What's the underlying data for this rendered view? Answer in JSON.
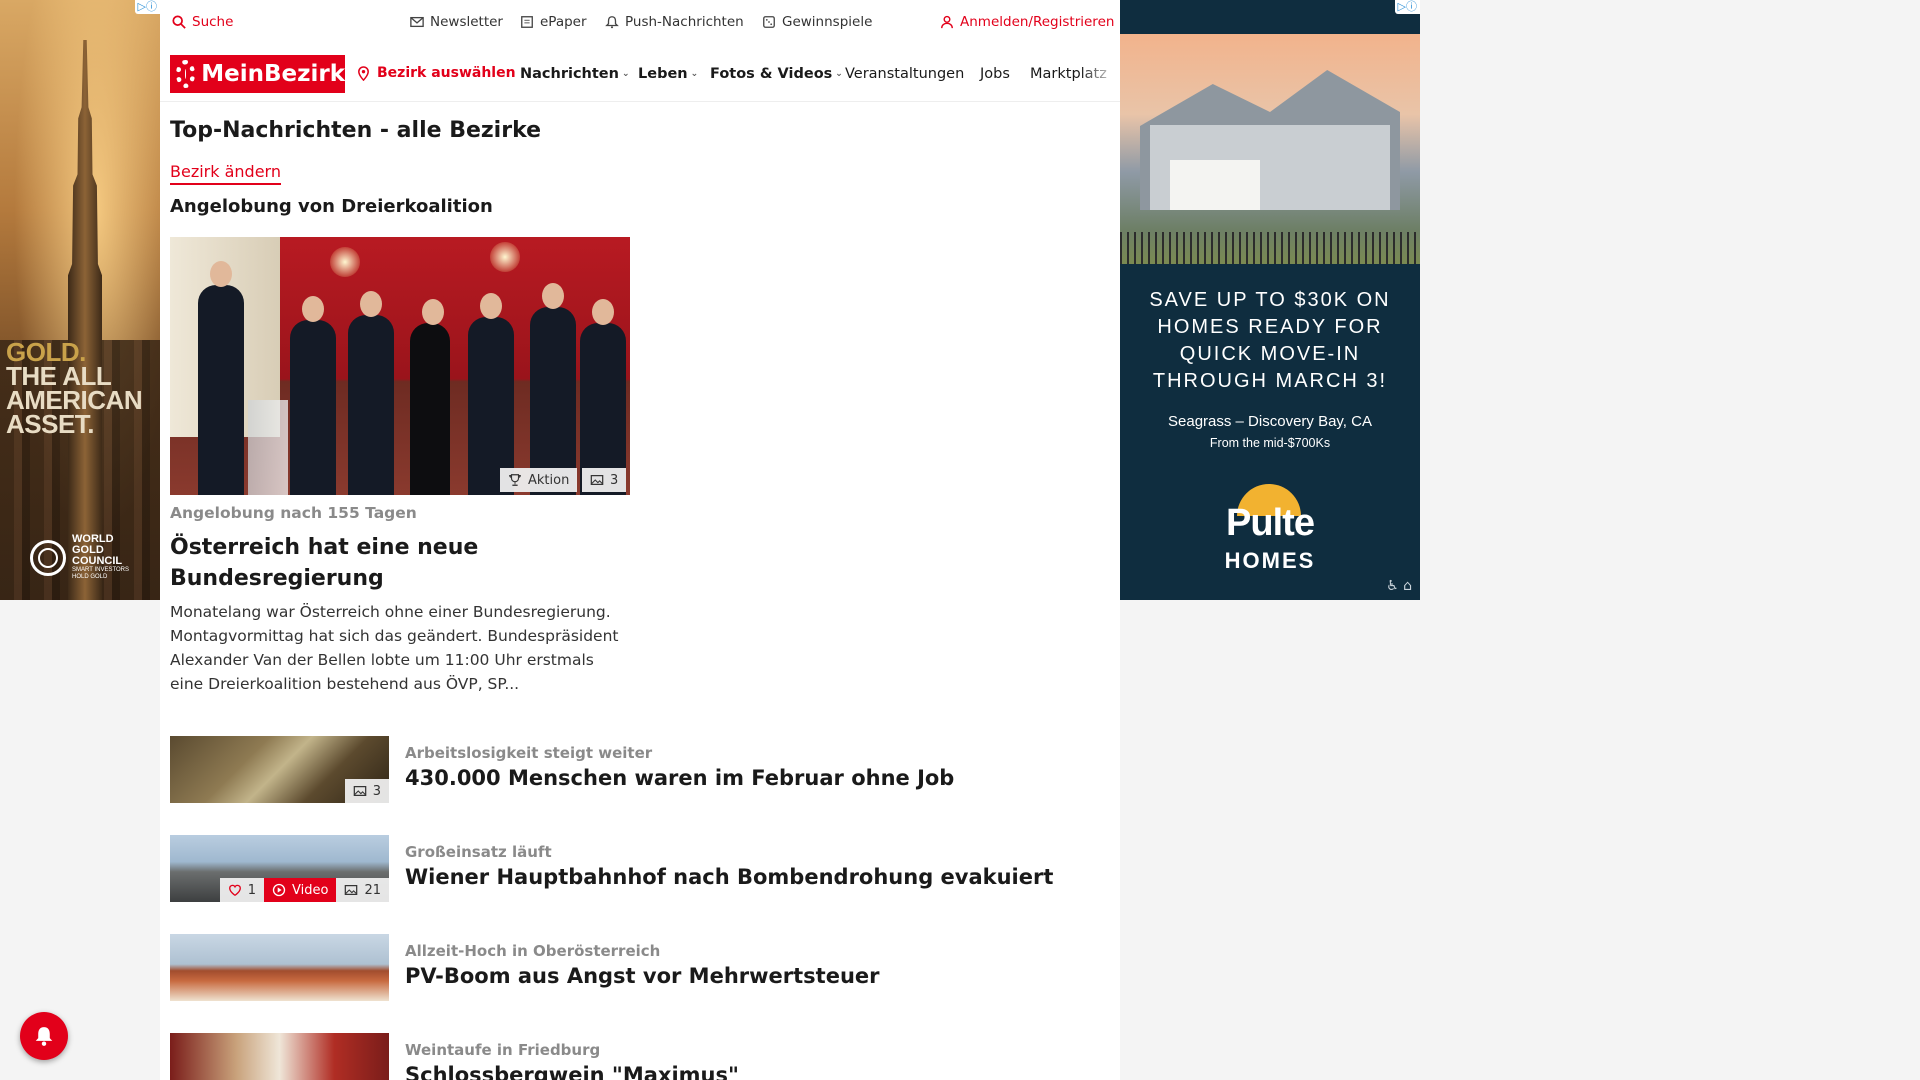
{
  "topbar": {
    "search": "Suche",
    "newsletter": "Newsletter",
    "epaper": "ePaper",
    "push": "Push-Nachrichten",
    "gewinnspiele": "Gewinnspiele",
    "login": "Anmelden/Registrieren"
  },
  "nav": {
    "logo": "MeinBezirk",
    "bezirk_select": "Bezirk auswählen",
    "items": [
      "Nachrichten",
      "Leben",
      "Fotos & Videos",
      "Veranstaltungen",
      "Jobs",
      "Marktplatz"
    ]
  },
  "page": {
    "title": "Top-Nachrichten - alle Bezirke",
    "change_bezirk": "Bezirk ändern",
    "section_title": "Angelobung von Dreierkoalition"
  },
  "hero": {
    "kicker": "Angelobung nach 155 Tagen",
    "title": "Österreich hat eine neue Bundesregierung",
    "teaser": "Monatelang war Österreich ohne einer Bundesregierung. Montagvormittag hat sich das geändert. Bundespräsident Alexander Van der Bellen lobte um 11:00 Uhr erstmals eine Dreierkoalition bestehend aus ÖVP, SP...",
    "badge_aktion": "Aktion",
    "badge_photos": "3"
  },
  "articles": [
    {
      "kicker": "Arbeitslosigkeit steigt weiter",
      "title": "430.000 Menschen waren im Februar ohne Job",
      "photos": "3"
    },
    {
      "kicker": "Großeinsatz läuft",
      "title": "Wiener Hauptbahnhof nach Bombendrohung evakuiert",
      "likes": "1",
      "video": "Video",
      "photos": "21"
    },
    {
      "kicker": "Allzeit-Hoch in Oberösterreich",
      "title": "PV-Boom aus Angst vor Mehrwertsteuer"
    },
    {
      "kicker": "Weintaufe in Friedburg",
      "title": "Schlossbergwein \"Maximus\""
    }
  ],
  "ad_left": {
    "line1": "GOLD.",
    "line2": "THE ALL AMERICAN ASSET.",
    "brand": "WORLD GOLD COUNCIL",
    "tagline": "SMART INVESTORS HOLD GOLD"
  },
  "ad_right": {
    "headline": "SAVE UP TO $30K ON HOMES READY FOR QUICK MOVE-IN THROUGH MARCH 3!",
    "location": "Seagrass – Discovery Bay, CA",
    "price": "From the mid-$700Ks",
    "brand": "Pulte",
    "brand_sub": "HOMES"
  },
  "colors": {
    "brand_red": "#e2001a",
    "ad_navy": "#0f2d3f"
  }
}
